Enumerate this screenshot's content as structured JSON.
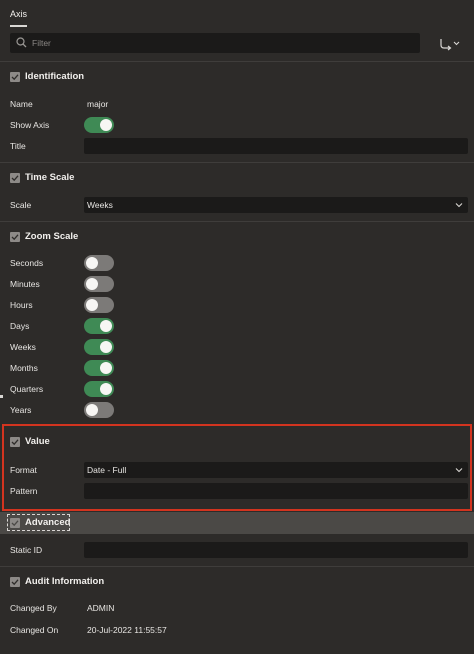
{
  "tabs": [
    {
      "label": "Axis"
    }
  ],
  "filter": {
    "placeholder": "Filter"
  },
  "sections": {
    "identification": {
      "title": "Identification",
      "name_label": "Name",
      "name_value": "major",
      "show_axis_label": "Show Axis",
      "show_axis": true,
      "title_label": "Title",
      "title_value": ""
    },
    "time_scale": {
      "title": "Time Scale",
      "scale_label": "Scale",
      "scale_value": "Weeks"
    },
    "zoom_scale": {
      "title": "Zoom Scale",
      "items": [
        {
          "label": "Seconds",
          "on": false
        },
        {
          "label": "Minutes",
          "on": false
        },
        {
          "label": "Hours",
          "on": false
        },
        {
          "label": "Days",
          "on": true
        },
        {
          "label": "Weeks",
          "on": true
        },
        {
          "label": "Months",
          "on": true
        },
        {
          "label": "Quarters",
          "on": true
        },
        {
          "label": "Years",
          "on": false
        }
      ]
    },
    "value": {
      "title": "Value",
      "format_label": "Format",
      "format_value": "Date - Full",
      "pattern_label": "Pattern",
      "pattern_value": ""
    },
    "advanced": {
      "title": "Advanced",
      "static_id_label": "Static ID",
      "static_id_value": ""
    },
    "audit": {
      "title": "Audit Information",
      "changed_by_label": "Changed By",
      "changed_by_value": "ADMIN",
      "changed_on_label": "Changed On",
      "changed_on_value": "20-Jul-2022 11:55:57"
    }
  },
  "colors": {
    "background": "#2d2b29",
    "field": "#1b1a19",
    "toggle_on": "#3f8a55",
    "toggle_off": "#7c7a78",
    "highlight_border": "#d3341f",
    "advanced_band": "#4b4946"
  },
  "icons": {
    "search": "search-icon",
    "goto": "goto-group-icon",
    "section_toggle": "collapse-check-icon",
    "select": "chevron-down-icon"
  }
}
